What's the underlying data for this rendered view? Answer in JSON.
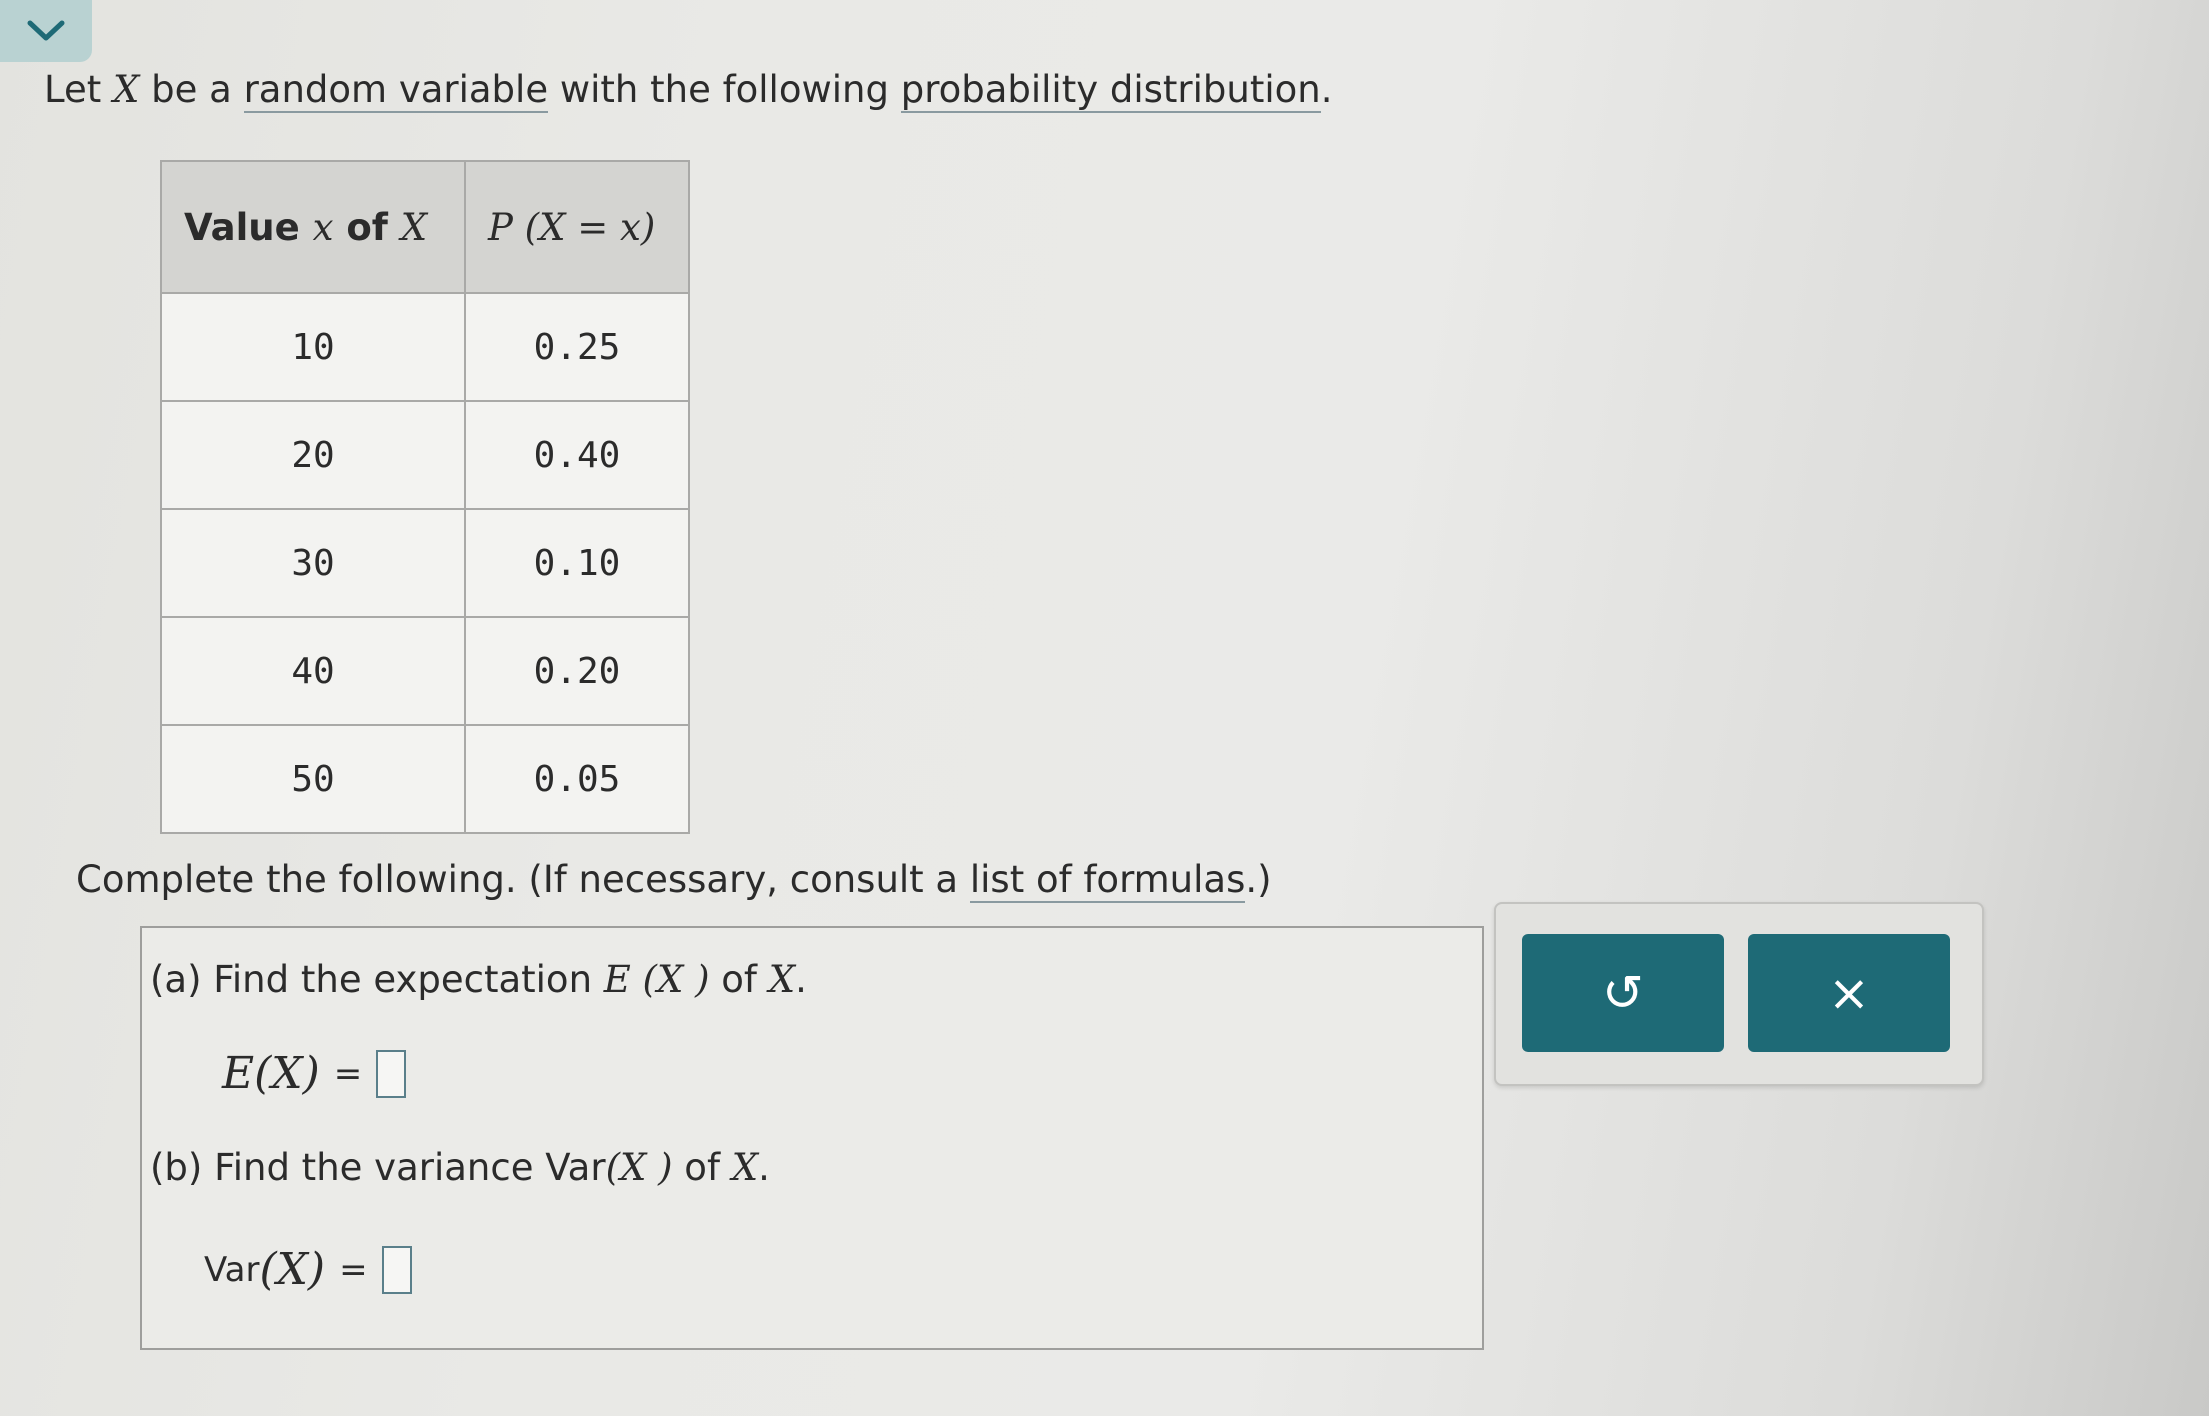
{
  "intro": {
    "prefix": "Let ",
    "var": "X",
    "middle": " be a ",
    "link1": "random variable",
    "middle2": " with the following ",
    "link2": "probability distribution",
    "suffix": "."
  },
  "table": {
    "header_x_prefix": "Value ",
    "header_x_var": "x",
    "header_x_mid": " of ",
    "header_x_var2": "X",
    "header_p": "P (X = x)",
    "rows": [
      {
        "x": "10",
        "p": "0.25"
      },
      {
        "x": "20",
        "p": "0.40"
      },
      {
        "x": "30",
        "p": "0.10"
      },
      {
        "x": "40",
        "p": "0.20"
      },
      {
        "x": "50",
        "p": "0.05"
      }
    ]
  },
  "complete": {
    "prefix": "Complete the following. (If necessary, consult a ",
    "link": "list of formulas",
    "suffix": ".)"
  },
  "part_a": {
    "label": "(a) Find the expectation ",
    "expr": "E (X )",
    "of": " of ",
    "var": "X",
    "end": ".",
    "eq_lhs": "E(X)",
    "eq_sign": "=",
    "input_value": ""
  },
  "part_b": {
    "label": "(b) Find the variance ",
    "expr_fn": "Var",
    "expr_arg": "(X )",
    "of": " of ",
    "var": "X",
    "end": ".",
    "eq_fn": "Var",
    "eq_arg": "(X)",
    "eq_sign": "=",
    "input_value": ""
  },
  "buttons": {
    "undo_glyph": "↺",
    "clear_glyph": "×"
  },
  "colors": {
    "button": "#1e6a76",
    "chevron_tab": "#b9d2d2"
  },
  "icons": {
    "collapse": "chevron-down-icon",
    "undo": "undo-icon",
    "clear": "close-icon"
  }
}
